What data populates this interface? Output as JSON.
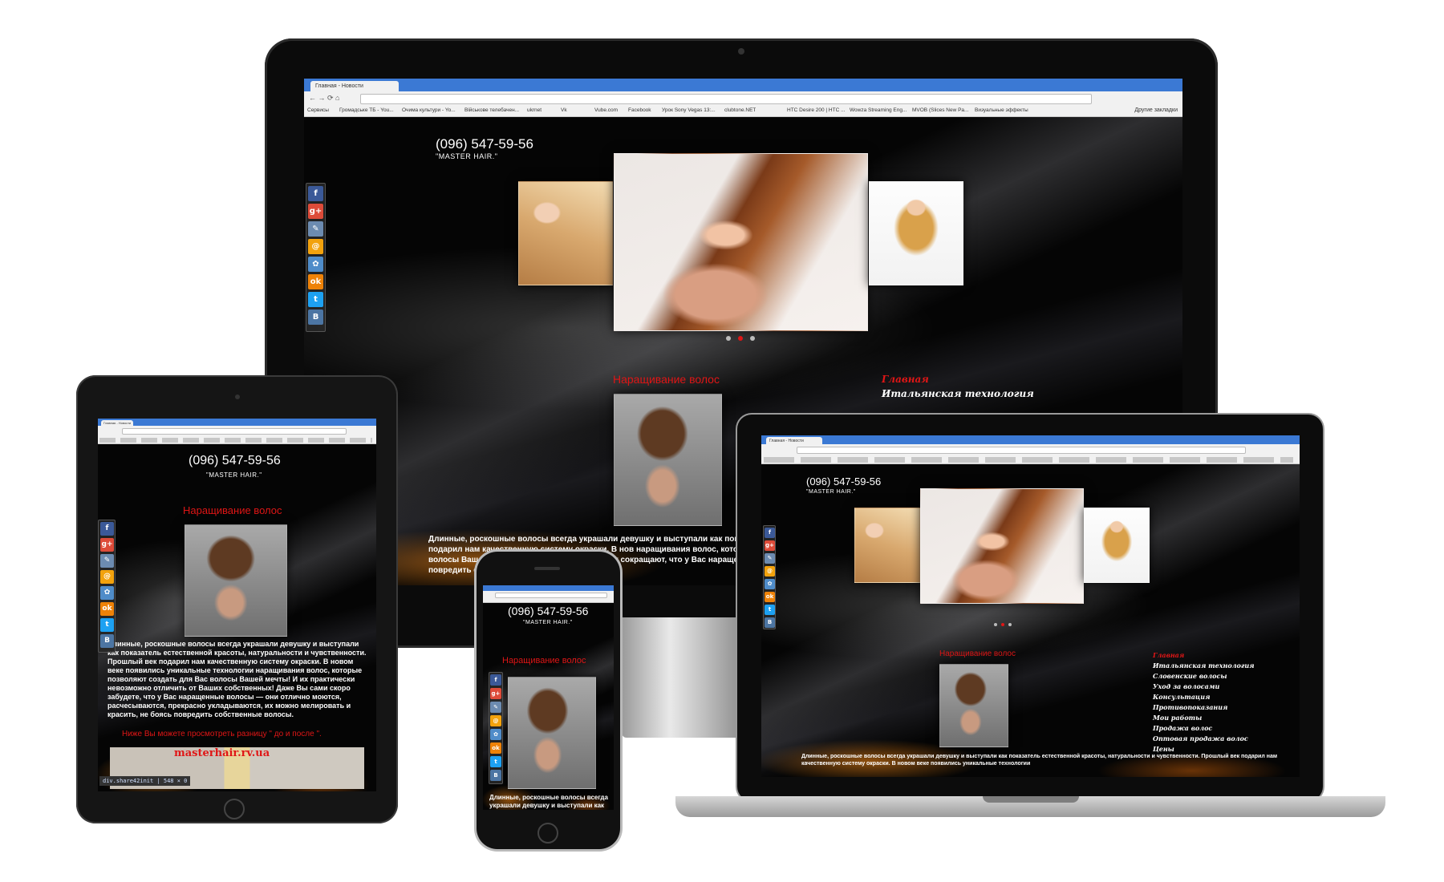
{
  "site": {
    "phone": "(096) 547-59-56",
    "brand": "\"MASTER HAIR.\"",
    "section_title": "Наращивание волос",
    "paragraph_short": "Длинные, роскошные волосы всегда украшали девушку и выступали как показатель естественной красоты, натуральности и чувственности. Прошлый век подарил нам качественную систему окраски. В новом веке появились уникальные технологии",
    "paragraph_desktop": "Длинные, роскошные волосы всегда украшали девушку и выступали как показат чувственности. Прошлый век подарил нам качественную систему окраски. В нов наращивания волос, которые позволяют создать для Вас волосы Вашей мечты! Ваших собс прекрасно у сокращают, что у Вас наращенные волосы красить, не боясь повредить с",
    "paragraph_tablet": "Длинные, роскошные волосы всегда украшали девушку и выступали как показатель естественной красоты, натуральности и чувственности. Прошлый век подарил нам качественную систему окраски. В новом веке появились уникальные технологии наращивания волос, которые позволяют создать для Вас волосы Вашей мечты! И их практически невозможно отличить от Ваших собственных! Даже Вы сами скоро забудете, что у Вас наращенные волосы — они отлично моются, расчесываются, прекрасно укладываются, их можно мелировать и красить, не боясь повредить собственные волосы.",
    "paragraph_phone": "Длинные, роскошные волосы всегда украшали девушку и выступали как",
    "compare_text": "Ниже Вы можете просмотреть разницу \" до и после \".",
    "watermark": "masterhair.rv.ua",
    "devtools_tag": "div.share42init",
    "devtools_size": "548 × 0",
    "menu": [
      "Главная",
      "Итальянская технология",
      "Словенские волосы",
      "Уход за волосами",
      "Консультация",
      "Противопоказания",
      "Мои работы",
      "Продажа волос",
      "Оптовая продажа волос",
      "Цены"
    ]
  },
  "browser": {
    "tab_title": "Главная - Новости",
    "bookmarks": [
      "Сервисы",
      "Громадське ТБ - You...",
      "Очима культури - Yo...",
      "Військове телебачен...",
      "ukrnet",
      "Vk",
      "Vube.com",
      "Facebook",
      "Урок Sony Vegas 13:...",
      "clubtone.NET",
      "HTC Desire 200 | HTC ...",
      "Wowza Streaming Eng...",
      "MVOB (Slices New Pa...",
      "Визуальные эффекты"
    ],
    "other_bookmarks": "Другие закладки"
  },
  "social": [
    {
      "name": "facebook",
      "glyph": "f",
      "color": "#3b5998"
    },
    {
      "name": "google-plus",
      "glyph": "g+",
      "color": "#dd4b39"
    },
    {
      "name": "livejournal",
      "glyph": "✎",
      "color": "#6c8bb0"
    },
    {
      "name": "mail-ru",
      "glyph": "@",
      "color": "#f2a20d"
    },
    {
      "name": "myworld",
      "glyph": "✿",
      "color": "#4f8cc9"
    },
    {
      "name": "odnoklassniki",
      "glyph": "ok",
      "color": "#ee8208"
    },
    {
      "name": "twitter",
      "glyph": "t",
      "color": "#1da1f2"
    },
    {
      "name": "vkontakte",
      "glyph": "B",
      "color": "#4c75a3"
    }
  ]
}
